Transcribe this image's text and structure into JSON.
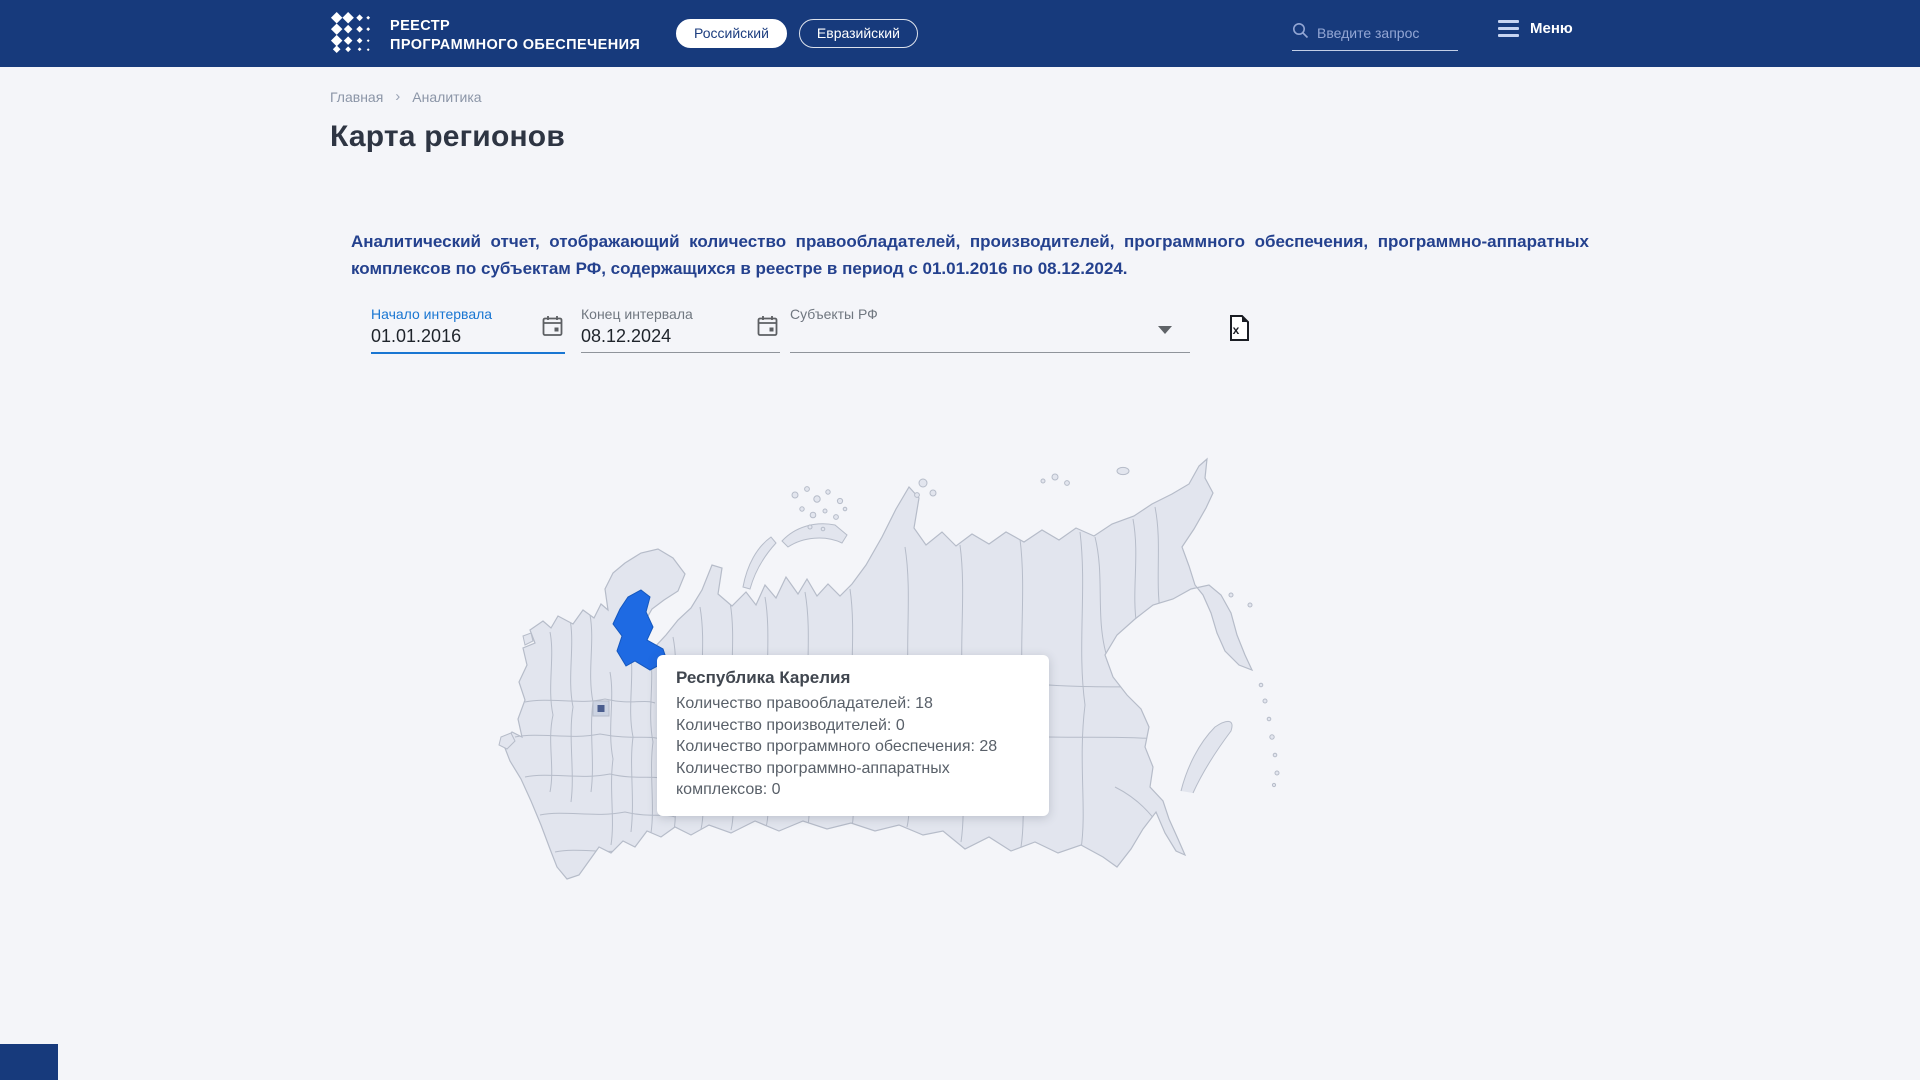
{
  "header": {
    "logo": {
      "line1": "РЕЕСТР",
      "line2": "ПРОГРАММНОГО ОБЕСПЕЧЕНИЯ"
    },
    "registry_tabs": [
      {
        "label": "Российский",
        "active": true
      },
      {
        "label": "Евразийский",
        "active": false
      }
    ],
    "search": {
      "placeholder": "Введите запрос"
    },
    "menu_label": "Меню"
  },
  "breadcrumb": {
    "home": "Главная",
    "current": "Аналитика"
  },
  "page": {
    "title": "Карта регионов",
    "description": "Аналитический отчет, отображающий количество правообладателей, производителей, программного обеспечения, программно-аппаратных комплексов по субъектам РФ, содержащихся в реестре в период с 01.01.2016 по 08.12.2024."
  },
  "filters": {
    "interval_start": {
      "label": "Начало интервала",
      "value": "01.01.2016"
    },
    "interval_end": {
      "label": "Конец интервала",
      "value": "08.12.2024"
    },
    "subjects": {
      "label": "Субъекты РФ",
      "value": ""
    }
  },
  "map": {
    "highlighted_region": "Республика Карелия",
    "tooltip": {
      "region": "Республика Карелия",
      "rows": [
        "Количество правообладателей: 18",
        "Количество производителей: 0",
        "Количество программного обеспечения: 28",
        "Количество программно-аппаратных комплексов: 0"
      ],
      "stats": {
        "rightholders": 18,
        "producers": 0,
        "software": 28,
        "hardware_software_complexes": 0
      }
    }
  },
  "colors": {
    "header_bg": "#173a7c",
    "accent_blue": "#1976d2",
    "page_bg": "#f4f5f9",
    "region_fill": "#e2e5ee",
    "region_border": "#b6bcc9",
    "highlight_region": "#1e6ae3",
    "description_text": "#24418e"
  }
}
